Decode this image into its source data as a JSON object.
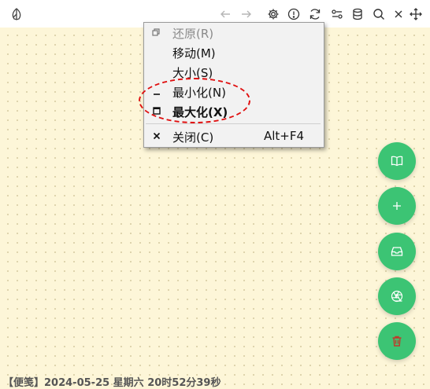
{
  "titlebar": {
    "icons": [
      "app-logo-icon",
      "back-arrow-icon",
      "forward-arrow-icon",
      "gear-icon",
      "info-icon",
      "refresh-icon",
      "toggle-icon",
      "database-icon",
      "search-icon",
      "close-icon",
      "move-icon"
    ]
  },
  "menu": {
    "items": [
      {
        "label": "还原(R)",
        "icon": "restore-icon",
        "state": "disabled"
      },
      {
        "label": "移动(M)",
        "icon": "",
        "state": "normal"
      },
      {
        "label": "大小(S)",
        "icon": "",
        "state": "normal"
      },
      {
        "label": "最小化(N)",
        "icon": "minimize-icon",
        "state": "normal"
      },
      {
        "label": "最大化(X)",
        "icon": "maximize-icon",
        "state": "bold"
      },
      {
        "label": "关闭(C)",
        "icon": "close-icon",
        "state": "normal",
        "shortcut": "Alt+F4"
      }
    ]
  },
  "fabs": [
    "book-icon",
    "plus-icon",
    "inbox-icon",
    "aperture-icon",
    "trash-icon"
  ],
  "colors": {
    "fab": "#3cc474",
    "trash": "#c0392b",
    "background": "#fdf6d8",
    "highlight": "#e01010"
  },
  "footer": {
    "text": "【便笺】2024-05-25 星期六 20时52分39秒"
  }
}
